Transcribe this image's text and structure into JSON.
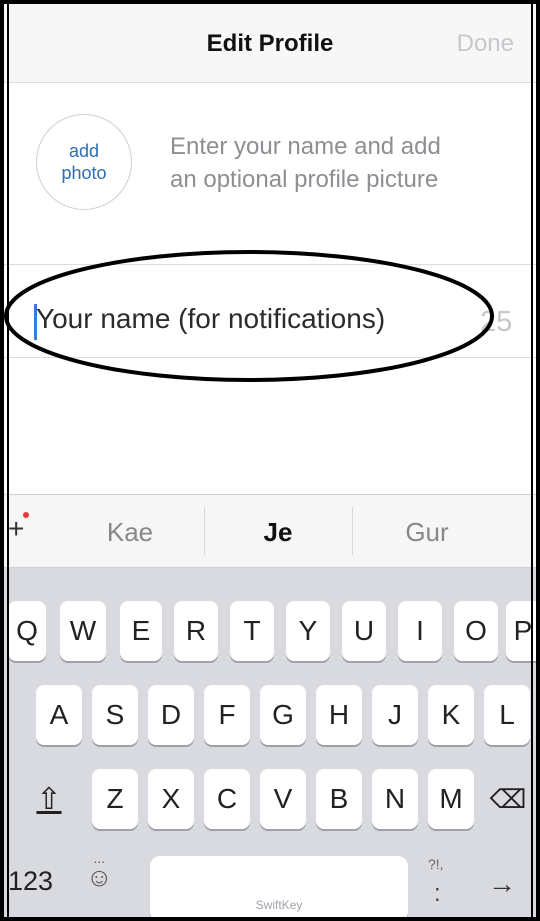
{
  "header": {
    "title": "Edit Profile",
    "done_label": "Done"
  },
  "profile": {
    "avatar_label": "add\nphoto",
    "hint": "Enter your name and add\nan optional profile picture"
  },
  "name_field": {
    "placeholder": "Your name (for notifications)",
    "char_count": "25"
  },
  "suggestions": {
    "plus": "+",
    "items": [
      "Kae",
      "Je",
      "Gur"
    ]
  },
  "keyboard": {
    "row1": [
      "Q",
      "W",
      "E",
      "R",
      "T",
      "Y",
      "U",
      "I",
      "O",
      "P"
    ],
    "row2": [
      "A",
      "S",
      "D",
      "F",
      "G",
      "H",
      "J",
      "K",
      "L"
    ],
    "row3": [
      "Z",
      "X",
      "C",
      "V",
      "B",
      "N",
      "M"
    ],
    "numbers_label": "123",
    "emoji_label": "☺",
    "emoji_dots": "...",
    "space_brand": "SwiftKey",
    "punct_label": "?!,",
    "punct_dots": ":",
    "enter_symbol": "→",
    "shift_symbol": "⇧",
    "backspace_symbol": "⌫"
  },
  "colors": {
    "accent": "#3a7bd5",
    "link": "#2a6fb5",
    "muted": "#8e8e93",
    "circle_annotation": "#000000"
  }
}
